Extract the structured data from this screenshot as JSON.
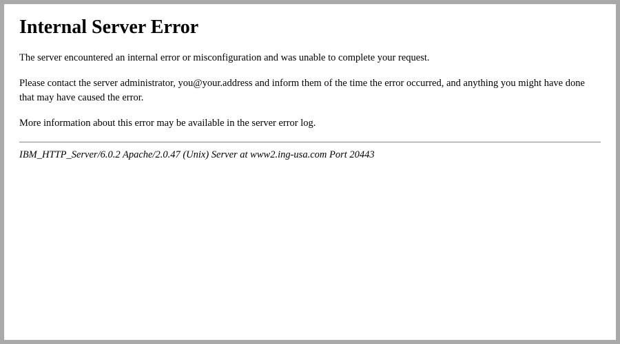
{
  "error_page": {
    "title": "Internal Server Error",
    "paragraph1": "The server encountered an internal error or misconfiguration and was unable to complete your request.",
    "paragraph2": "Please contact the server administrator, you@your.address and inform them of the time the error occurred, and anything you might have done that may have caused the error.",
    "paragraph3": "More information about this error may be available in the server error log.",
    "server_signature": "IBM_HTTP_Server/6.0.2 Apache/2.0.47 (Unix) Server at www2.ing-usa.com Port 20443"
  }
}
